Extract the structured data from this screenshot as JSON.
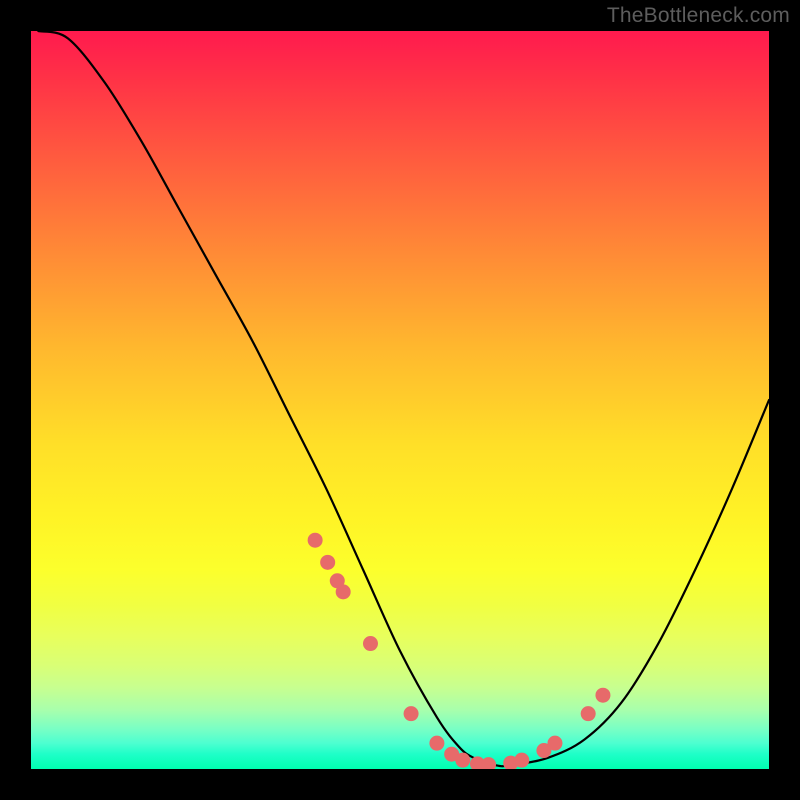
{
  "watermark": "TheBottleneck.com",
  "chart_data": {
    "type": "line",
    "title": "",
    "xlabel": "",
    "ylabel": "",
    "xlim": [
      0,
      100
    ],
    "ylim": [
      0,
      100
    ],
    "series": [
      {
        "name": "curve",
        "x": [
          1,
          5,
          10,
          15,
          20,
          25,
          30,
          35,
          40,
          45,
          50,
          55,
          58,
          60,
          63,
          65,
          70,
          75,
          80,
          85,
          90,
          95,
          100
        ],
        "y": [
          100,
          99,
          93,
          85,
          76,
          67,
          58,
          48,
          38,
          27,
          16,
          7,
          3,
          1.5,
          0.5,
          0.5,
          1.5,
          4,
          9,
          17,
          27,
          38,
          50
        ]
      }
    ],
    "markers": {
      "name": "highlight-dots",
      "color": "#e76a6a",
      "x": [
        38.5,
        40.2,
        41.5,
        42.3,
        46.0,
        51.5,
        55.0,
        57.0,
        58.5,
        60.5,
        62.0,
        65.0,
        66.5,
        69.5,
        71.0,
        75.5,
        77.5
      ],
      "y": [
        31.0,
        28.0,
        25.5,
        24.0,
        17.0,
        7.5,
        3.5,
        2.0,
        1.2,
        0.7,
        0.6,
        0.8,
        1.2,
        2.5,
        3.5,
        7.5,
        10.0
      ]
    }
  }
}
